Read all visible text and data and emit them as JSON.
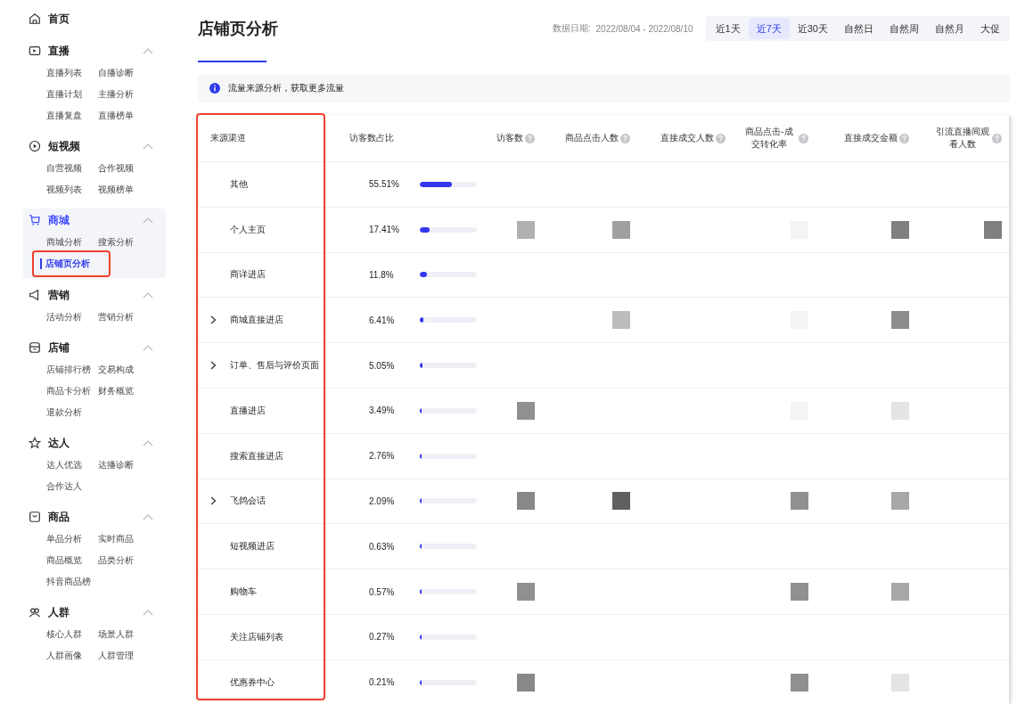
{
  "sidebar": {
    "home": {
      "label": "首页"
    },
    "sections": [
      {
        "kind": "live",
        "title": "直播",
        "selected": false,
        "expanded": true,
        "items": [
          {
            "label": "直播列表",
            "selected": false
          },
          {
            "label": "自播诊断",
            "selected": false
          },
          {
            "label": "直播计划",
            "selected": false
          },
          {
            "label": "主播分析",
            "selected": false
          },
          {
            "label": "直播复盘",
            "selected": false
          },
          {
            "label": "直播榜单",
            "selected": false
          }
        ]
      },
      {
        "kind": "video",
        "title": "短视频",
        "selected": false,
        "expanded": true,
        "items": [
          {
            "label": "自营视频",
            "selected": false
          },
          {
            "label": "合作视频",
            "selected": false
          },
          {
            "label": "视频列表",
            "selected": false
          },
          {
            "label": "视频榜单",
            "selected": false
          }
        ]
      },
      {
        "kind": "cart",
        "title": "商城",
        "selected": true,
        "expanded": true,
        "items": [
          {
            "label": "商城分析",
            "selected": false
          },
          {
            "label": "搜索分析",
            "selected": false
          },
          {
            "label": "店铺页分析",
            "selected": true
          }
        ]
      },
      {
        "kind": "megaphone",
        "title": "营销",
        "selected": false,
        "expanded": true,
        "items": [
          {
            "label": "活动分析",
            "selected": false
          },
          {
            "label": "营销分析",
            "selected": false
          }
        ]
      },
      {
        "kind": "shop",
        "title": "店铺",
        "selected": false,
        "expanded": true,
        "items": [
          {
            "label": "店铺排行榜",
            "selected": false
          },
          {
            "label": "交易构成",
            "selected": false
          },
          {
            "label": "商品卡分析",
            "selected": false
          },
          {
            "label": "财务概览",
            "selected": false
          },
          {
            "label": "退款分析",
            "selected": false
          }
        ]
      },
      {
        "kind": "star",
        "title": "达人",
        "selected": false,
        "expanded": true,
        "items": [
          {
            "label": "达人优选",
            "selected": false
          },
          {
            "label": "达播诊断",
            "selected": false
          },
          {
            "label": "合作达人",
            "selected": false
          }
        ]
      },
      {
        "kind": "bag",
        "title": "商品",
        "selected": false,
        "expanded": true,
        "items": [
          {
            "label": "单品分析",
            "selected": false
          },
          {
            "label": "实时商品",
            "selected": false
          },
          {
            "label": "商品概览",
            "selected": false
          },
          {
            "label": "品类分析",
            "selected": false
          },
          {
            "label": "抖音商品榜",
            "selected": false
          }
        ]
      },
      {
        "kind": "people",
        "title": "人群",
        "selected": false,
        "expanded": true,
        "items": [
          {
            "label": "核心人群",
            "selected": false
          },
          {
            "label": "场景人群",
            "selected": false
          },
          {
            "label": "人群画像",
            "selected": false
          },
          {
            "label": "人群管理",
            "selected": false
          }
        ]
      }
    ]
  },
  "header": {
    "title": "店铺页分析",
    "date_label": "数据日期:",
    "date_range": "2022/08/04 - 2022/08/10",
    "ranges": [
      {
        "label": "近1天",
        "selected": false
      },
      {
        "label": "近7天",
        "selected": true
      },
      {
        "label": "近30天",
        "selected": false
      },
      {
        "label": "自然日",
        "selected": false
      },
      {
        "label": "自然周",
        "selected": false
      },
      {
        "label": "自然月",
        "selected": false
      },
      {
        "label": "大促",
        "selected": false
      }
    ]
  },
  "notice": {
    "text": "流量来源分析，获取更多流量"
  },
  "table": {
    "columns": [
      {
        "label": "来源渠道",
        "help": false
      },
      {
        "label": "访客数占比",
        "help": false
      },
      {
        "label": "访客数",
        "help": true
      },
      {
        "label": "商品点击人数",
        "help": true
      },
      {
        "label": "直接成交人数",
        "help": true
      },
      {
        "label": "商品点击-成交转化率",
        "help": true
      },
      {
        "label": "直接成交金额",
        "help": true
      },
      {
        "label": "引流直播间观看人数",
        "help": true
      }
    ],
    "rows": [
      {
        "kind": "leaf",
        "channel": "其他",
        "share": "55.51%",
        "level": 0.5551,
        "masks": [
          {
            "kind": "blank"
          },
          {
            "kind": "blank"
          },
          {
            "kind": "blank"
          },
          {
            "kind": "blank"
          },
          {
            "kind": "blank"
          },
          {
            "kind": "blank"
          }
        ]
      },
      {
        "kind": "leaf",
        "channel": "个人主页",
        "share": "17.41%",
        "level": 0.1741,
        "masks": [
          {
            "kind": "mask",
            "color": "#b0b0b0"
          },
          {
            "kind": "mask",
            "color": "#a0a0a0"
          },
          {
            "kind": "blank"
          },
          {
            "kind": "mask",
            "color": "#f4f4f4"
          },
          {
            "kind": "mask",
            "color": "#808080"
          },
          {
            "kind": "mask",
            "color": "#808080"
          }
        ]
      },
      {
        "kind": "leaf",
        "channel": "商详进店",
        "share": "11.8%",
        "level": 0.118,
        "masks": [
          {
            "kind": "blank"
          },
          {
            "kind": "blank"
          },
          {
            "kind": "blank"
          },
          {
            "kind": "blank"
          },
          {
            "kind": "blank"
          },
          {
            "kind": "blank"
          }
        ]
      },
      {
        "kind": "group",
        "channel": "商城直接进店",
        "share": "6.41%",
        "level": 0.0641,
        "masks": [
          {
            "kind": "blank"
          },
          {
            "kind": "mask",
            "color": "#bcbcbc"
          },
          {
            "kind": "blank"
          },
          {
            "kind": "mask",
            "color": "#f4f4f4"
          },
          {
            "kind": "mask",
            "color": "#8c8c8c"
          },
          {
            "kind": "blank"
          }
        ]
      },
      {
        "kind": "group",
        "channel": "订单、售后与评价页面",
        "share": "5.05%",
        "level": 0.0505,
        "masks": [
          {
            "kind": "blank"
          },
          {
            "kind": "blank"
          },
          {
            "kind": "blank"
          },
          {
            "kind": "blank"
          },
          {
            "kind": "blank"
          },
          {
            "kind": "blank"
          }
        ]
      },
      {
        "kind": "leaf",
        "channel": "直播进店",
        "share": "3.49%",
        "level": 0.0349,
        "masks": [
          {
            "kind": "mask",
            "color": "#909090"
          },
          {
            "kind": "blank"
          },
          {
            "kind": "blank"
          },
          {
            "kind": "mask",
            "color": "#f4f4f4"
          },
          {
            "kind": "mask",
            "color": "#e4e4e4"
          },
          {
            "kind": "blank"
          }
        ]
      },
      {
        "kind": "leaf",
        "channel": "搜索直接进店",
        "share": "2.76%",
        "level": 0.0276,
        "masks": [
          {
            "kind": "blank"
          },
          {
            "kind": "blank"
          },
          {
            "kind": "blank"
          },
          {
            "kind": "blank"
          },
          {
            "kind": "blank"
          },
          {
            "kind": "blank"
          }
        ]
      },
      {
        "kind": "group",
        "channel": "飞鸽会话",
        "share": "2.09%",
        "level": 0.0209,
        "masks": [
          {
            "kind": "mask",
            "color": "#888888"
          },
          {
            "kind": "mask",
            "color": "#606060"
          },
          {
            "kind": "blank"
          },
          {
            "kind": "mask",
            "color": "#909090"
          },
          {
            "kind": "mask",
            "color": "#a8a8a8"
          },
          {
            "kind": "blank"
          }
        ]
      },
      {
        "kind": "leaf",
        "channel": "短视频进店",
        "share": "0.63%",
        "level": 0.0063,
        "masks": [
          {
            "kind": "blank"
          },
          {
            "kind": "blank"
          },
          {
            "kind": "blank"
          },
          {
            "kind": "blank"
          },
          {
            "kind": "blank"
          },
          {
            "kind": "blank"
          }
        ]
      },
      {
        "kind": "leaf",
        "channel": "购物车",
        "share": "0.57%",
        "level": 0.0057,
        "masks": [
          {
            "kind": "mask",
            "color": "#909090"
          },
          {
            "kind": "blank"
          },
          {
            "kind": "blank"
          },
          {
            "kind": "mask",
            "color": "#909090"
          },
          {
            "kind": "mask",
            "color": "#a8a8a8"
          },
          {
            "kind": "blank"
          }
        ]
      },
      {
        "kind": "leaf",
        "channel": "关注店铺列表",
        "share": "0.27%",
        "level": 0.0027,
        "masks": [
          {
            "kind": "blank"
          },
          {
            "kind": "blank"
          },
          {
            "kind": "blank"
          },
          {
            "kind": "blank"
          },
          {
            "kind": "blank"
          },
          {
            "kind": "blank"
          }
        ]
      },
      {
        "kind": "leaf",
        "channel": "优惠券中心",
        "share": "0.21%",
        "level": 0.0021,
        "masks": [
          {
            "kind": "mask",
            "color": "#888888"
          },
          {
            "kind": "blank"
          },
          {
            "kind": "blank"
          },
          {
            "kind": "mask",
            "color": "#909090"
          },
          {
            "kind": "mask",
            "color": "#e4e4e4"
          },
          {
            "kind": "blank"
          }
        ]
      }
    ]
  }
}
